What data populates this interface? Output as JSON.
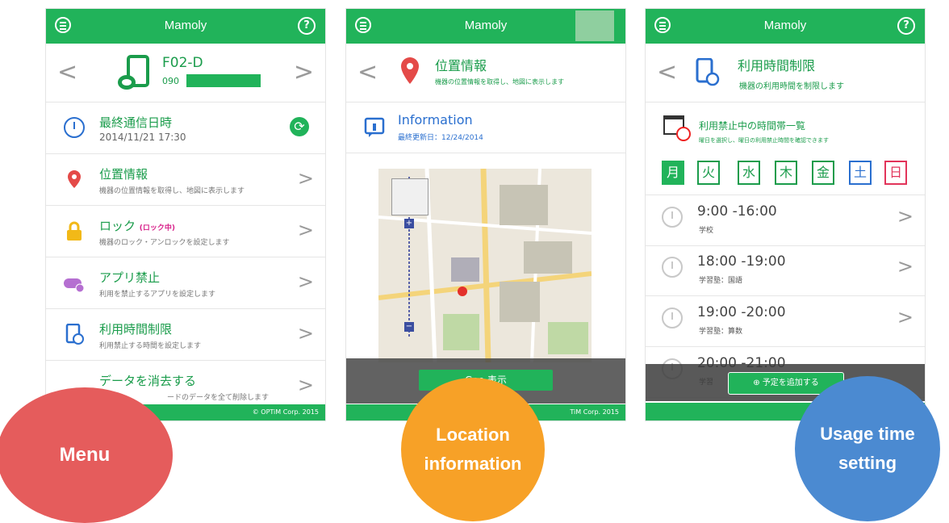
{
  "colors": {
    "green": "#21b35a",
    "menu_circle": "#e55c5c",
    "location_circle": "#f7a127",
    "usage_circle": "#4b8ad1"
  },
  "app_title": "Mamoly",
  "screen1": {
    "device_name": "F02-D",
    "device_number": "090",
    "last_comm_label": "最終通信日時",
    "last_comm_value": "2014/11/21 17:30",
    "items": [
      {
        "label": "位置情報",
        "sub": "機器の位置情報を取得し、地図に表示します",
        "icon": "pin-icon"
      },
      {
        "label": "ロック",
        "badge": "(ロック中)",
        "sub": "機器のロック・アンロックを設定します",
        "icon": "lock-icon"
      },
      {
        "label": "アプリ禁止",
        "sub": "利用を禁止するアプリを設定します",
        "icon": "gamepad-icon"
      },
      {
        "label": "利用時間制限",
        "sub": "利用禁止する時間を設定します",
        "icon": "phone-clock-icon"
      },
      {
        "label": "データを消去する",
        "sub": "ードのデータを全て削除します",
        "icon": "erase-icon"
      }
    ],
    "footer": "© OPTiM Corp. 2015"
  },
  "screen2": {
    "header_title": "位置情報",
    "header_sub": "機器の位置情報を取得し、地図に表示します",
    "info_title": "Information",
    "info_sub": "最終更新日：12/24/2014",
    "map_button": "Goo    表示",
    "footer": "TiM Corp. 2015"
  },
  "screen3": {
    "header_title": "利用時間制限",
    "header_sub": "機器の利用時間を制限します",
    "list_title": "利用禁止中の時間帯一覧",
    "list_sub": "曜日を選択し、曜日の利用禁止時間を確認できます",
    "days": [
      "月",
      "火",
      "水",
      "木",
      "金",
      "土",
      "日"
    ],
    "slots": [
      {
        "time": "9:00 -16:00",
        "sub": "学校"
      },
      {
        "time": "18:00 -19:00",
        "sub": "学習塾：国語"
      },
      {
        "time": "19:00 -20:00",
        "sub": "学習塾：算数"
      },
      {
        "time": "20:00 -21:00",
        "sub": "学習"
      }
    ],
    "add_button": "予定を追加する"
  },
  "labels": {
    "menu": "Menu",
    "location": "Location information",
    "usage": "Usage time setting"
  }
}
